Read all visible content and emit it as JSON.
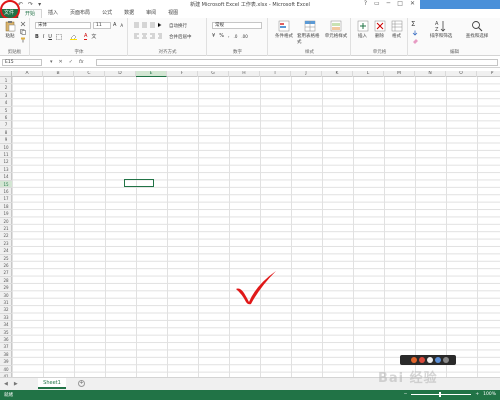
{
  "titlebar": {
    "title": "新建 Microsoft Excel 工作表.xlsx - Microsoft Excel",
    "qat": [
      "↶",
      "↷",
      "▾"
    ],
    "controls": [
      "?",
      "▭",
      "─",
      "□",
      "✕"
    ]
  },
  "tabs": [
    {
      "label": "文件"
    },
    {
      "label": "开始"
    },
    {
      "label": "插入"
    },
    {
      "label": "页面布局"
    },
    {
      "label": "公式"
    },
    {
      "label": "数据"
    },
    {
      "label": "审阅"
    },
    {
      "label": "视图"
    }
  ],
  "ribbon": {
    "clipboard": {
      "label": "剪贴板",
      "paste": "粘贴"
    },
    "font": {
      "label": "字体",
      "font_name": "宋体",
      "font_size": "11",
      "bold": "B",
      "italic": "I",
      "underline": "U",
      "grow": "A",
      "color_a": "A",
      "wen": "文"
    },
    "alignment": {
      "label": "对齐方式",
      "wrap": "自动换行",
      "merge": "合并后居中"
    },
    "number": {
      "label": "数字",
      "format": "常规",
      "percent": "%",
      "comma": ",",
      "dec_up": ".0",
      "dec_down": ".00"
    },
    "styles": {
      "label": "样式",
      "cond": "条件格式",
      "table": "套用表格格式",
      "cell": "单元格样式"
    },
    "cells": {
      "label": "单元格",
      "insert": "插入",
      "delete": "删除",
      "format": "格式"
    },
    "editing": {
      "label": "编辑",
      "sigma": "Σ",
      "sort": "排序和筛选",
      "find": "查找和选择"
    }
  },
  "formula_bar": {
    "namebox": "E15",
    "fx_icons": [
      "▾",
      "✕",
      "✓",
      "fx"
    ]
  },
  "columns": [
    "A",
    "B",
    "C",
    "D",
    "E",
    "F",
    "G",
    "H",
    "I",
    "J",
    "K",
    "L",
    "M",
    "N",
    "O",
    "P",
    "Q"
  ],
  "rows": [
    "1",
    "2",
    "3",
    "4",
    "5",
    "6",
    "7",
    "8",
    "9",
    "10",
    "11",
    "12",
    "13",
    "14",
    "15",
    "16",
    "17",
    "18",
    "19",
    "20",
    "21",
    "22",
    "23",
    "24",
    "25",
    "26",
    "27",
    "28",
    "29",
    "30",
    "31",
    "32",
    "33",
    "34",
    "35",
    "36",
    "37",
    "38",
    "39",
    "40",
    "41"
  ],
  "selected_column": "E",
  "selected_row": "15",
  "sheets": [
    {
      "label": "Sheet1"
    }
  ],
  "sheet_nav": [
    "◀",
    "▶"
  ],
  "add_sheet": "+",
  "status": {
    "text": "就绪",
    "zoom": "100%",
    "zoom_minus": "−",
    "zoom_plus": "+"
  },
  "watermark": {
    "text": "Bai 经验"
  },
  "colors": {
    "accent": "#217346",
    "annotation": "#e01818",
    "corner_block": "#4a90d9"
  }
}
